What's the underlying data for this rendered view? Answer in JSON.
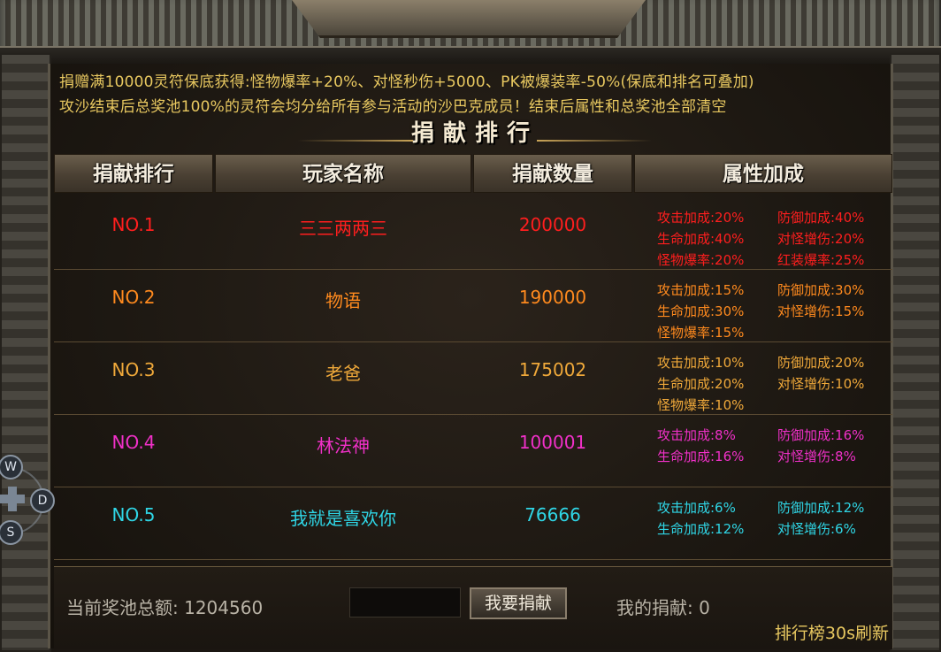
{
  "notice": {
    "line1": "捐赠满10000灵符保底获得:怪物爆率+20%、对怪秒伤+5000、PK被爆装率-50%(保底和排名可叠加)",
    "line2": "攻沙结束后总奖池100%的灵符会均分给所有参与活动的沙巴克成员！结束后属性和总奖池全部清空"
  },
  "title": "捐献排行",
  "headers": [
    "捐献排行",
    "玩家名称",
    "捐献数量",
    "属性加成"
  ],
  "rows": [
    {
      "rank": "NO.1",
      "name": "三三两两三",
      "amount": "200000",
      "color": "#ff1e1e",
      "attrs": [
        "攻击加成:20%",
        "防御加成:40%",
        "生命加成:40%",
        "对怪增伤:20%",
        "怪物爆率:20%",
        "红装爆率:25%"
      ]
    },
    {
      "rank": "NO.2",
      "name": "物语",
      "amount": "190000",
      "color": "#ff8a1e",
      "attrs": [
        "攻击加成:15%",
        "防御加成:30%",
        "生命加成:30%",
        "对怪增伤:15%",
        "怪物爆率:15%",
        ""
      ]
    },
    {
      "rank": "NO.3",
      "name": "老爸",
      "amount": "175002",
      "color": "#f0a93a",
      "attrs": [
        "攻击加成:10%",
        "防御加成:20%",
        "生命加成:20%",
        "对怪增伤:10%",
        "怪物爆率:10%",
        ""
      ]
    },
    {
      "rank": "NO.4",
      "name": "林法神",
      "amount": "100001",
      "color": "#f030c8",
      "attrs": [
        "攻击加成:8%",
        "防御加成:16%",
        "生命加成:16%",
        "对怪增伤:8%",
        "",
        ""
      ]
    },
    {
      "rank": "NO.5",
      "name": "我就是喜欢你",
      "amount": "76666",
      "color": "#2fd6e6",
      "attrs": [
        "攻击加成:6%",
        "防御加成:12%",
        "生命加成:12%",
        "对怪增伤:6%",
        "",
        ""
      ]
    }
  ],
  "footer": {
    "pool_label": "当前奖池总额: 1204560",
    "donate_button": "我要捐献",
    "my_donation": "我的捐献: 0",
    "refresh_note": "排行榜30s刷新",
    "input_value": ""
  },
  "controls": {
    "w": "W",
    "d": "D",
    "s": "S"
  }
}
